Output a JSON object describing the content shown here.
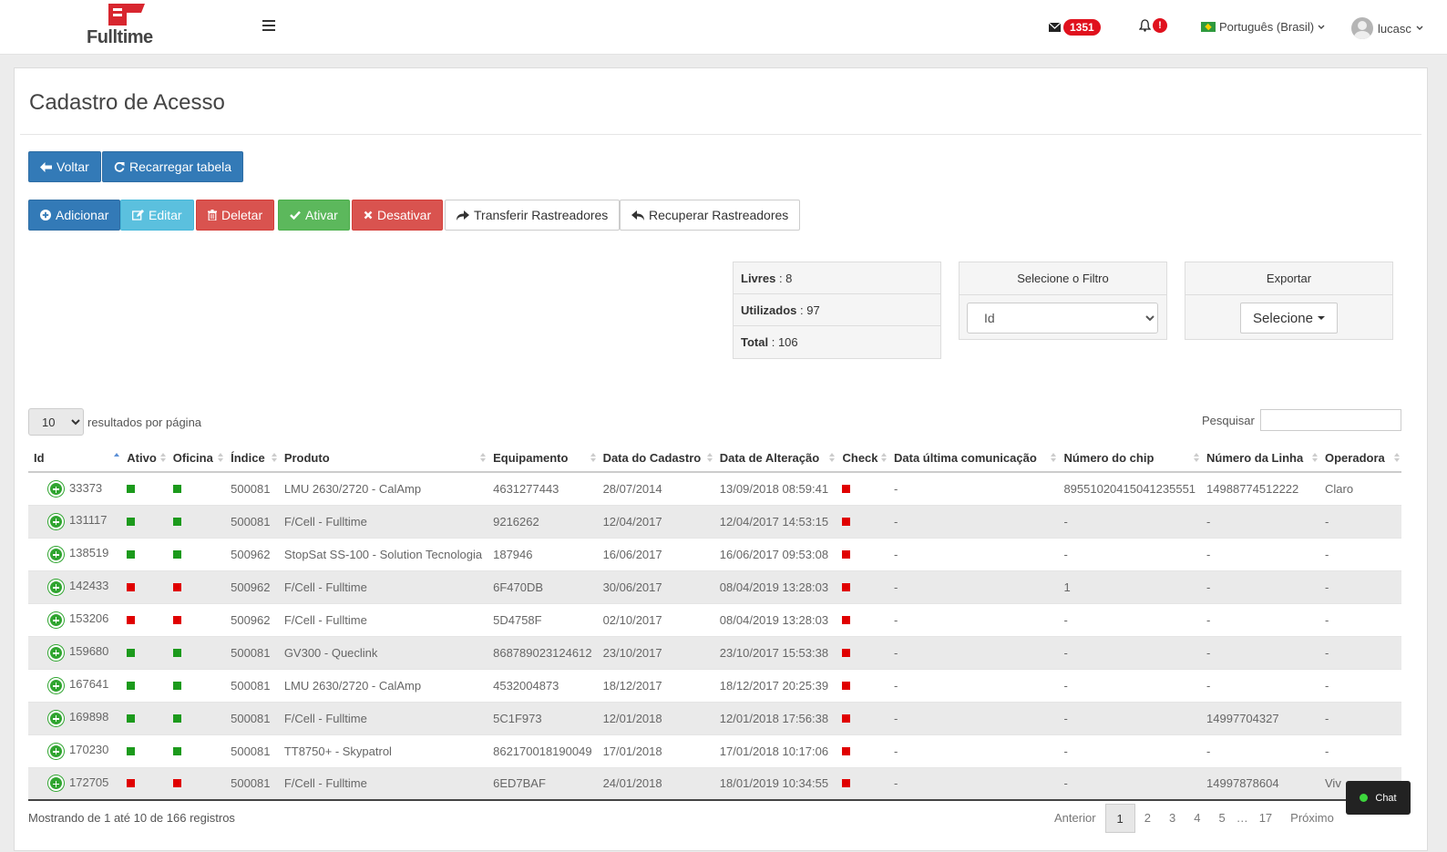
{
  "header": {
    "brand": "Fulltime",
    "mail_count": "1351",
    "alert_badge": "!",
    "language": "Português (Brasil)",
    "username": "lucasc"
  },
  "page": {
    "title": "Cadastro de Acesso"
  },
  "toolbar1": {
    "voltar": "Voltar",
    "recarregar": "Recarregar tabela"
  },
  "toolbar2": {
    "adicionar": "Adicionar",
    "editar": "Editar",
    "deletar": "Deletar",
    "ativar": "Ativar",
    "desativar": "Desativar",
    "transferir": "Transferir Rastreadores",
    "recuperar": "Recuperar Rastreadores"
  },
  "stats": {
    "livres_label": "Livres",
    "livres_value": ": 8",
    "utilizados_label": "Utilizados",
    "utilizados_value": ": 97",
    "total_label": "Total",
    "total_value": ": 106"
  },
  "filter": {
    "heading": "Selecione o Filtro",
    "selected": "Id"
  },
  "export": {
    "heading": "Exportar",
    "button": "Selecione"
  },
  "table_controls": {
    "page_length": "10",
    "length_label": "resultados por página",
    "search_label": "Pesquisar"
  },
  "table": {
    "columns": [
      "Id",
      "Ativo",
      "Oficina",
      "Índice",
      "Produto",
      "Equipamento",
      "Data do Cadastro",
      "Data de Alteração",
      "Check",
      "Data última comunicação",
      "Número do chip",
      "Número da Linha",
      "Operadora"
    ],
    "rows": [
      {
        "id": "33373",
        "ativo": "green",
        "oficina": "green",
        "indice": "500081",
        "produto": "LMU 2630/2720 - CalAmp",
        "equipamento": "4631277443",
        "cadastro": "28/07/2014",
        "alteracao": "13/09/2018 08:59:41",
        "check": "red",
        "ultima": "-",
        "chip": "89551020415041235551",
        "linha": "14988774512222",
        "operadora": "Claro"
      },
      {
        "id": "131117",
        "ativo": "green",
        "oficina": "green",
        "indice": "500081",
        "produto": "F/Cell - Fulltime",
        "equipamento": "9216262",
        "cadastro": "12/04/2017",
        "alteracao": "12/04/2017 14:53:15",
        "check": "red",
        "ultima": "-",
        "chip": "-",
        "linha": "-",
        "operadora": "-"
      },
      {
        "id": "138519",
        "ativo": "green",
        "oficina": "green",
        "indice": "500962",
        "produto": "StopSat SS-100 - Solution Tecnologia",
        "equipamento": "187946",
        "cadastro": "16/06/2017",
        "alteracao": "16/06/2017 09:53:08",
        "check": "red",
        "ultima": "-",
        "chip": "-",
        "linha": "-",
        "operadora": "-"
      },
      {
        "id": "142433",
        "ativo": "red",
        "oficina": "red",
        "indice": "500962",
        "produto": "F/Cell - Fulltime",
        "equipamento": "6F470DB",
        "cadastro": "30/06/2017",
        "alteracao": "08/04/2019 13:28:03",
        "check": "red",
        "ultima": "-",
        "chip": "1",
        "linha": "-",
        "operadora": "-"
      },
      {
        "id": "153206",
        "ativo": "red",
        "oficina": "red",
        "indice": "500962",
        "produto": "F/Cell - Fulltime",
        "equipamento": "5D4758F",
        "cadastro": "02/10/2017",
        "alteracao": "08/04/2019 13:28:03",
        "check": "red",
        "ultima": "-",
        "chip": "-",
        "linha": "-",
        "operadora": "-"
      },
      {
        "id": "159680",
        "ativo": "green",
        "oficina": "green",
        "indice": "500081",
        "produto": "GV300 - Queclink",
        "equipamento": "868789023124612",
        "cadastro": "23/10/2017",
        "alteracao": "23/10/2017 15:53:38",
        "check": "red",
        "ultima": "-",
        "chip": "-",
        "linha": "-",
        "operadora": "-"
      },
      {
        "id": "167641",
        "ativo": "green",
        "oficina": "green",
        "indice": "500081",
        "produto": "LMU 2630/2720 - CalAmp",
        "equipamento": "4532004873",
        "cadastro": "18/12/2017",
        "alteracao": "18/12/2017 20:25:39",
        "check": "red",
        "ultima": "-",
        "chip": "-",
        "linha": "-",
        "operadora": "-"
      },
      {
        "id": "169898",
        "ativo": "green",
        "oficina": "green",
        "indice": "500081",
        "produto": "F/Cell - Fulltime",
        "equipamento": "5C1F973",
        "cadastro": "12/01/2018",
        "alteracao": "12/01/2018 17:56:38",
        "check": "red",
        "ultima": "-",
        "chip": "-",
        "linha": "14997704327",
        "operadora": "-"
      },
      {
        "id": "170230",
        "ativo": "green",
        "oficina": "green",
        "indice": "500081",
        "produto": "TT8750+ - Skypatrol",
        "equipamento": "862170018190049",
        "cadastro": "17/01/2018",
        "alteracao": "17/01/2018 10:17:06",
        "check": "red",
        "ultima": "-",
        "chip": "-",
        "linha": "-",
        "operadora": "-"
      },
      {
        "id": "172705",
        "ativo": "red",
        "oficina": "red",
        "indice": "500081",
        "produto": "F/Cell - Fulltime",
        "equipamento": "6ED7BAF",
        "cadastro": "24/01/2018",
        "alteracao": "18/01/2019 10:34:55",
        "check": "red",
        "ultima": "-",
        "chip": "-",
        "linha": "14997878604",
        "operadora": "Viv"
      }
    ]
  },
  "footer": {
    "info": "Mostrando de 1 até 10 de 166 registros",
    "prev": "Anterior",
    "pages": [
      "1",
      "2",
      "3",
      "4",
      "5"
    ],
    "ellipsis": "…",
    "last": "17",
    "next": "Próximo",
    "chat": "Chat"
  },
  "colors": {
    "primary": "#337ab7",
    "info": "#5bc0de",
    "danger": "#d9534f",
    "success": "#5cb85c",
    "status_green": "#1c9a1c",
    "status_red": "#e00000",
    "badge_red": "#e0111d"
  }
}
